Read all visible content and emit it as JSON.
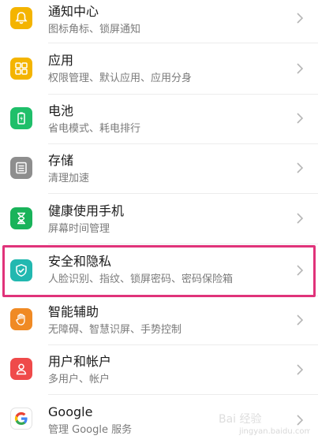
{
  "items": [
    {
      "title": "通知中心",
      "subtitle": "图标角标、锁屏通知",
      "icon": "bell-icon",
      "color": "#f4b400"
    },
    {
      "title": "应用",
      "subtitle": "权限管理、默认应用、应用分身",
      "icon": "apps-grid-icon",
      "color": "#f4b400"
    },
    {
      "title": "电池",
      "subtitle": "省电模式、耗电排行",
      "icon": "battery-icon",
      "color": "#1fbf6a"
    },
    {
      "title": "存储",
      "subtitle": "清理加速",
      "icon": "storage-icon",
      "color": "#8e8e8e"
    },
    {
      "title": "健康使用手机",
      "subtitle": "屏幕时间管理",
      "icon": "hourglass-icon",
      "color": "#19b35a"
    },
    {
      "title": "安全和隐私",
      "subtitle": "人脸识别、指纹、锁屏密码、密码保险箱",
      "icon": "shield-check-icon",
      "color": "#22b8b0"
    },
    {
      "title": "智能辅助",
      "subtitle": "无障碍、智慧识屏、手势控制",
      "icon": "hand-icon",
      "color": "#f08a24"
    },
    {
      "title": "用户和帐户",
      "subtitle": "多用户、帐户",
      "icon": "user-icon",
      "color": "#ef4a4a"
    },
    {
      "title": "Google",
      "subtitle": "管理 Google 服务",
      "icon": "google-icon",
      "color": "#4285f4"
    }
  ],
  "highlight_color": "#e0337a",
  "watermark": {
    "text": "jingyan.baidu.com",
    "logo": "Bai 经验"
  }
}
